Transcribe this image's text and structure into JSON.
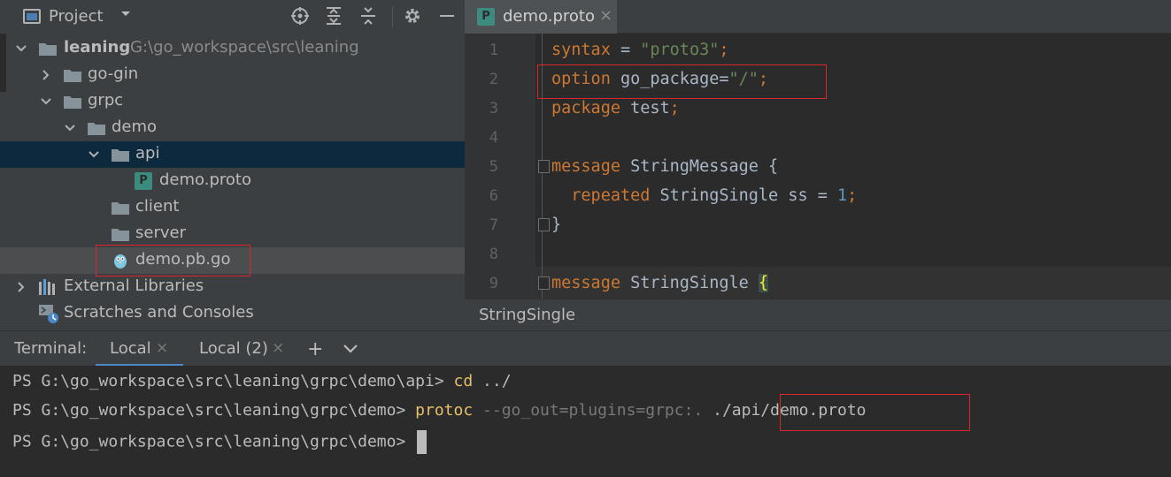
{
  "project_panel": {
    "title": "Project",
    "tree": [
      {
        "label": "leaning",
        "path": "G:\\go_workspace\\src\\leaning"
      },
      {
        "label": "go-gin"
      },
      {
        "label": "grpc"
      },
      {
        "label": "demo"
      },
      {
        "label": "api"
      },
      {
        "label": "demo.proto"
      },
      {
        "label": "client"
      },
      {
        "label": "server"
      },
      {
        "label": "demo.pb.go"
      },
      {
        "label": "External Libraries"
      },
      {
        "label": "Scratches and Consoles"
      }
    ]
  },
  "editor": {
    "tab": {
      "label": "demo.proto",
      "icon_letter": "P"
    },
    "line_numbers": [
      "1",
      "2",
      "3",
      "4",
      "5",
      "6",
      "7",
      "8",
      "9"
    ],
    "code": {
      "l1_kw": "syntax",
      "l1_eq": " = ",
      "l1_str": "\"proto3\"",
      "l1_semi": ";",
      "l2_kw": "option",
      "l2_text": " go_package=",
      "l2_str": "\"/\"",
      "l2_semi": ";",
      "l3_kw": "package",
      "l3_text": " test",
      "l3_semi": ";",
      "l5_kw": "message",
      "l5_text": " StringMessage {",
      "l6_indent": "  ",
      "l6_kw": "repeated",
      "l6_text": " StringSingle ss = ",
      "l6_num": "1",
      "l6_semi": ";",
      "l7_text": "}",
      "l9_kw": "message",
      "l9_text": " StringSingle ",
      "l9_brace": "{"
    },
    "breadcrumb": "StringSingle"
  },
  "terminal": {
    "title": "Terminal:",
    "tabs": [
      "Local",
      "Local (2)"
    ],
    "close_glyph": "×",
    "add_glyph": "+",
    "lines": {
      "l1_prompt": "PS G:\\go_workspace\\src\\leaning\\grpc\\demo\\api> ",
      "l1_cmd": "cd",
      "l1_args": " ../",
      "l2_prompt": "PS G:\\go_workspace\\src\\leaning\\grpc\\demo> ",
      "l2_cmd": "protoc",
      "l2_dim": " --go_out=plugins=grpc:. ",
      "l2_args": "./api/demo.proto",
      "l3_prompt": "PS G:\\go_workspace\\src\\leaning\\grpc\\demo> "
    }
  },
  "colors": {
    "keyword": "#cc7832",
    "string": "#6a8759",
    "number": "#6897bb",
    "highlight_box": "#e0232c",
    "selection": "#0d293e",
    "accent": "#4a88c7"
  }
}
